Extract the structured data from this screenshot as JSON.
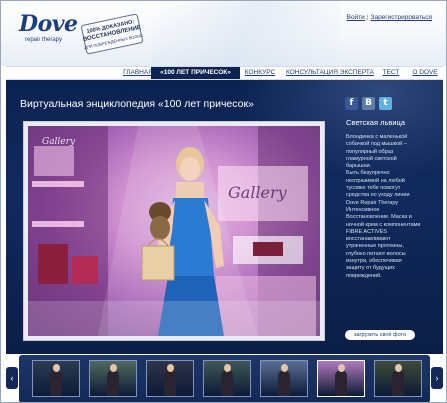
{
  "brand": {
    "name": "Dove",
    "sub": "repair therapy",
    "badge_line1": "100% ДОКАЗАНО:",
    "badge_line2": "ВОССТАНОВЛЕНИЕ",
    "badge_line3": "ДЛЯ ПОВРЕЖДЁННЫХ ВОЛОС",
    "color": "#1d3f7a"
  },
  "auth": {
    "login": "Войти",
    "register": "Зарегистрироваться"
  },
  "nav": {
    "items": [
      {
        "label": "ГЛАВНАЯ",
        "active": false
      },
      {
        "label": "«100 ЛЕТ ПРИЧЕСОК»",
        "active": true
      },
      {
        "label": "КОНКУРС",
        "active": false
      },
      {
        "label": "КОНСУЛЬТАЦИЯ ЭКСПЕРТА",
        "active": false
      },
      {
        "label": "ТЕСТ",
        "active": false
      },
      {
        "label": "О DOVE",
        "active": false
      }
    ]
  },
  "main": {
    "title": "Виртуальная энциклопедия «100 лет причесок»",
    "social": [
      {
        "name": "facebook-icon",
        "glyph": "f"
      },
      {
        "name": "vkontakte-icon",
        "glyph": "B"
      },
      {
        "name": "twitter-icon",
        "glyph": "t"
      }
    ],
    "photo": {
      "scene": "boutique",
      "sign_text_1": "Gallery",
      "sign_text_2": "Gallery"
    },
    "style_name": "Светская львица",
    "style_description": "Блондинка с маленькой\nсобачкой под мышкой –\nпопулярный образ\nгламурной светской\nбарышни.\nБыть безупречно\nнеотразимой на любой\nтусовке тебе помогут\nсредства по уходу линии\nDove Repair Therapy\nИнтенсивное\nВосстановление. Маска и\nночной крем с компонентами\nFIBRE ACTIVES\nвосстанавливают\nутраченные протеины,\nглубоко питают волосы\nизнутри, обеспечивая\nзащиту от будущих\nповреждений.",
    "upload_button": "загрузить своё фото"
  },
  "carousel": {
    "prev": "‹",
    "next": "›",
    "thumbs": [
      {
        "name": "thumb-1",
        "bg": "#2c3a52"
      },
      {
        "name": "thumb-2",
        "bg": "#4f6a5e"
      },
      {
        "name": "thumb-3",
        "bg": "#30344a"
      },
      {
        "name": "thumb-4",
        "bg": "#3e5757"
      },
      {
        "name": "thumb-5",
        "bg": "#5a6f94"
      },
      {
        "name": "thumb-6",
        "bg": "#b07ac0",
        "selected": true
      },
      {
        "name": "thumb-7",
        "bg": "#3f4b3a"
      }
    ]
  },
  "colors": {
    "panel": "#0c2250",
    "nav_active": "#0d2352",
    "accent_pink": "#d79bd6"
  }
}
